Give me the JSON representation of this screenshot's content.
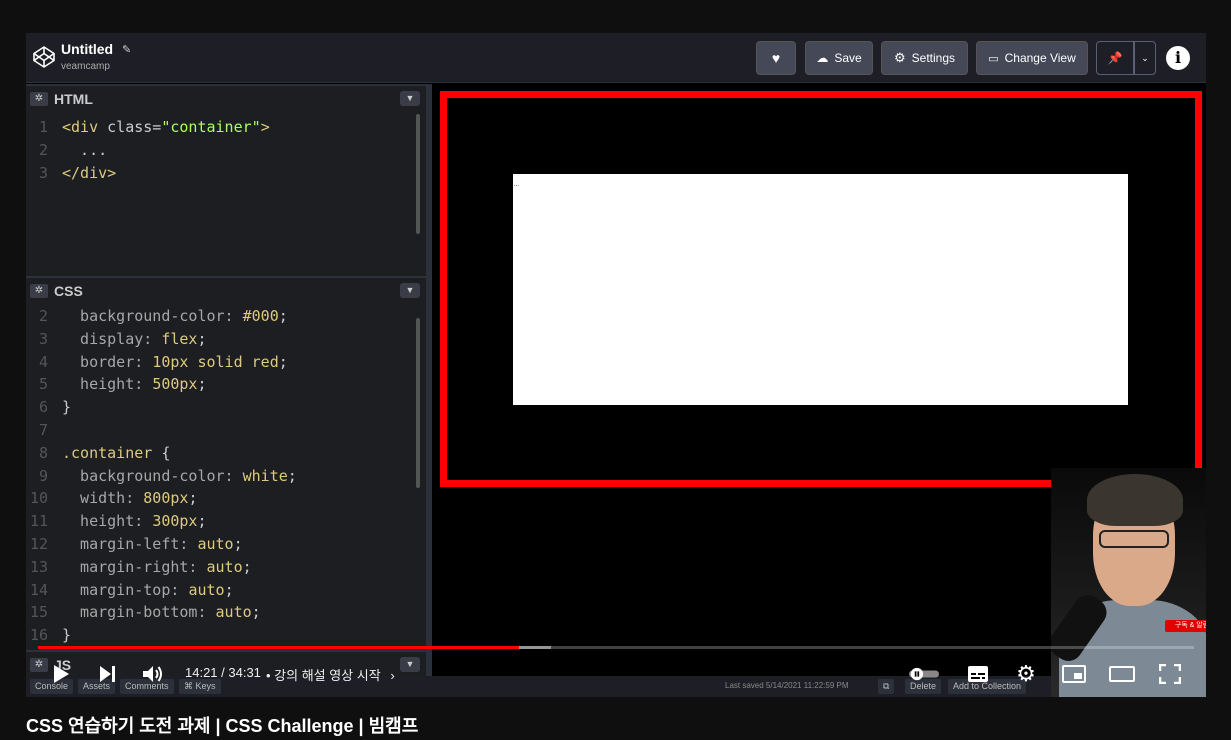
{
  "codepen": {
    "title": "Untitled",
    "user": "veamcamp",
    "buttons": {
      "save": "Save",
      "settings": "Settings",
      "change_view": "Change View"
    },
    "info_label": "i"
  },
  "editors": {
    "html": {
      "name": "HTML",
      "lines": [
        {
          "n": "1",
          "parts": [
            [
              "tag",
              "<div "
            ],
            [
              "pl",
              "class="
            ],
            [
              "str",
              "\"container\""
            ],
            [
              "tag",
              ">"
            ]
          ]
        },
        {
          "n": "2",
          "parts": [
            [
              "pl",
              "  ..."
            ]
          ]
        },
        {
          "n": "3",
          "parts": [
            [
              "tag",
              "</div>"
            ]
          ]
        }
      ]
    },
    "css": {
      "name": "CSS",
      "lines": [
        {
          "n": "2",
          "parts": [
            [
              "prop",
              "  background-color: "
            ],
            [
              "val",
              "#000"
            ],
            [
              "pl",
              ";"
            ]
          ]
        },
        {
          "n": "3",
          "parts": [
            [
              "prop",
              "  display: "
            ],
            [
              "val",
              "flex"
            ],
            [
              "pl",
              ";"
            ]
          ]
        },
        {
          "n": "4",
          "parts": [
            [
              "prop",
              "  border: "
            ],
            [
              "val",
              "10px solid red"
            ],
            [
              "pl",
              ";"
            ]
          ]
        },
        {
          "n": "5",
          "parts": [
            [
              "prop",
              "  height: "
            ],
            [
              "val",
              "500px"
            ],
            [
              "pl",
              ";"
            ]
          ]
        },
        {
          "n": "6",
          "parts": [
            [
              "pl",
              "}"
            ]
          ]
        },
        {
          "n": "7",
          "parts": [
            [
              "pl",
              ""
            ]
          ]
        },
        {
          "n": "8",
          "parts": [
            [
              "sel",
              ".container "
            ],
            [
              "pl",
              "{"
            ]
          ]
        },
        {
          "n": "9",
          "parts": [
            [
              "prop",
              "  background-color: "
            ],
            [
              "val",
              "white"
            ],
            [
              "pl",
              ";"
            ]
          ]
        },
        {
          "n": "10",
          "parts": [
            [
              "prop",
              "  width: "
            ],
            [
              "val",
              "800px"
            ],
            [
              "pl",
              ";"
            ]
          ]
        },
        {
          "n": "11",
          "parts": [
            [
              "prop",
              "  height: "
            ],
            [
              "val",
              "300px"
            ],
            [
              "pl",
              ";"
            ]
          ]
        },
        {
          "n": "12",
          "parts": [
            [
              "prop",
              "  margin-left: "
            ],
            [
              "val",
              "auto"
            ],
            [
              "pl",
              ";"
            ]
          ]
        },
        {
          "n": "13",
          "parts": [
            [
              "prop",
              "  margin-right: "
            ],
            [
              "val",
              "auto"
            ],
            [
              "pl",
              ";"
            ]
          ]
        },
        {
          "n": "14",
          "parts": [
            [
              "prop",
              "  margin-top: "
            ],
            [
              "val",
              "auto"
            ],
            [
              "pl",
              ";"
            ]
          ]
        },
        {
          "n": "15",
          "parts": [
            [
              "prop",
              "  margin-bottom: "
            ],
            [
              "val",
              "auto"
            ],
            [
              "pl",
              ";"
            ]
          ]
        },
        {
          "n": "16",
          "parts": [
            [
              "pl",
              "}"
            ]
          ]
        }
      ]
    },
    "js": {
      "name": "JS"
    }
  },
  "preview": {
    "dots": "..."
  },
  "cp_footer": {
    "console": "Console",
    "assets": "Assets",
    "comments": "Comments",
    "keys": "⌘ Keys",
    "last_saved": "Last saved 5/14/2021 11:22:59 PM",
    "delete": "Delete",
    "add_to_collection": "Add to Collection"
  },
  "webcam": {
    "badge": "구독 & 알림"
  },
  "player": {
    "time": "14:21 / 34:31",
    "chapter": "• 강의 해설 영상 시작",
    "progress": 0.416,
    "buffered": 0.444
  },
  "video_title": "CSS 연습하기 도전 과제 | CSS Challenge | 빔캠프"
}
